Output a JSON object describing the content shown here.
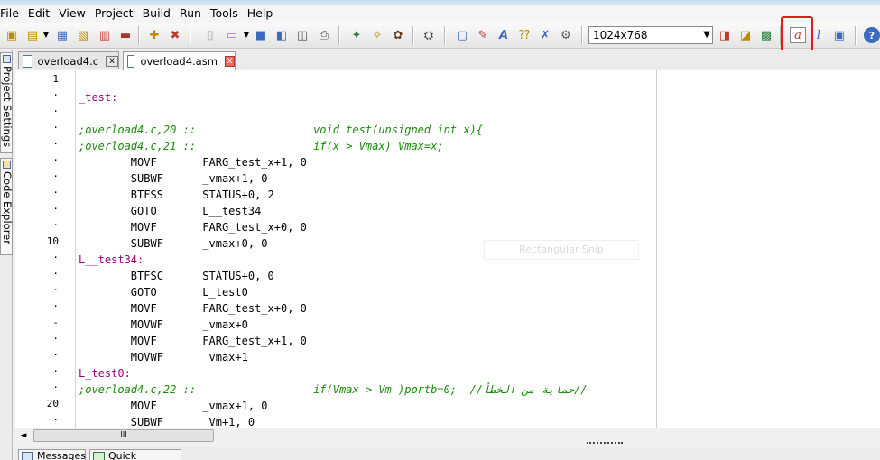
{
  "menu": [
    "File",
    "Edit",
    "View",
    "Project",
    "Build",
    "Run",
    "Tools",
    "Help"
  ],
  "toolbar": {
    "resolution_value": "1024x768",
    "help_glyph": "?"
  },
  "left_panel": {
    "tabs": [
      "Project Settings",
      "Code Explorer"
    ]
  },
  "tabs": [
    {
      "label": "overload4.c",
      "close": "x",
      "active": false
    },
    {
      "label": "overload4.asm",
      "close": "x",
      "active": true
    }
  ],
  "editor": {
    "line_numbers": [
      "1",
      "·",
      "·",
      "·",
      "·",
      "·",
      "·",
      "·",
      "·",
      "·",
      "10",
      "·",
      "·",
      "·",
      "·",
      "-",
      "·",
      "·",
      "·",
      "·",
      "20",
      "·",
      "·"
    ],
    "lines": [
      {
        "text": "",
        "kind": "instr"
      },
      {
        "text": "_test:",
        "kind": "label"
      },
      {
        "text": "",
        "kind": "instr"
      },
      {
        "text": ";overload4.c,20 ::                  void test(unsigned int x){",
        "kind": "comment"
      },
      {
        "text": ";overload4.c,21 ::                  if(x > Vmax) Vmax=x;",
        "kind": "comment"
      },
      {
        "text": "        MOVF       FARG_test_x+1, 0",
        "kind": "instr"
      },
      {
        "text": "        SUBWF      _vmax+1, 0",
        "kind": "instr"
      },
      {
        "text": "        BTFSS      STATUS+0, 2",
        "kind": "instr"
      },
      {
        "text": "        GOTO       L__test34",
        "kind": "instr"
      },
      {
        "text": "        MOVF       FARG_test_x+0, 0",
        "kind": "instr"
      },
      {
        "text": "        SUBWF      _vmax+0, 0",
        "kind": "instr"
      },
      {
        "text": "L__test34:",
        "kind": "label"
      },
      {
        "text": "        BTFSC      STATUS+0, 0",
        "kind": "instr"
      },
      {
        "text": "        GOTO       L_test0",
        "kind": "instr"
      },
      {
        "text": "        MOVF       FARG_test_x+0, 0",
        "kind": "instr"
      },
      {
        "text": "        MOVWF      _vmax+0",
        "kind": "instr"
      },
      {
        "text": "        MOVF       FARG_test_x+1, 0",
        "kind": "instr"
      },
      {
        "text": "        MOVWF      _vmax+1",
        "kind": "instr"
      },
      {
        "text": "L_test0:",
        "kind": "label"
      },
      {
        "text": ";overload4.c,22 ::                  if(Vmax > Vm )portb=0;  //حماية من الخطأ//",
        "kind": "comment"
      },
      {
        "text": "        MOVF       _vmax+1, 0",
        "kind": "instr"
      },
      {
        "text": "        SUBWF       Vm+1, 0",
        "kind": "instr"
      }
    ],
    "snip_overlay": "Rectangular Snip"
  },
  "scrollbar": {
    "left_arrow": "◄",
    "thumb_grip": "III"
  },
  "bottom_tabs": [
    "Messages",
    "Quick Converter"
  ],
  "colors": {
    "label": "#a0007a",
    "comment": "#1c8a0c",
    "highlight": "#e8191e"
  }
}
